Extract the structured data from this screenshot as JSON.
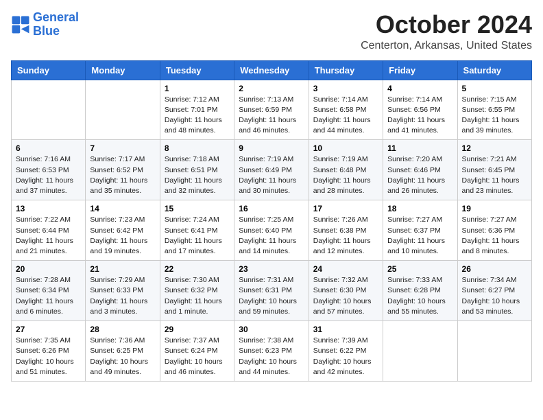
{
  "header": {
    "logo_line1": "General",
    "logo_line2": "Blue",
    "month": "October 2024",
    "location": "Centerton, Arkansas, United States"
  },
  "days_of_week": [
    "Sunday",
    "Monday",
    "Tuesday",
    "Wednesday",
    "Thursday",
    "Friday",
    "Saturday"
  ],
  "weeks": [
    [
      {
        "day": "",
        "info": ""
      },
      {
        "day": "",
        "info": ""
      },
      {
        "day": "1",
        "info": "Sunrise: 7:12 AM\nSunset: 7:01 PM\nDaylight: 11 hours and 48 minutes."
      },
      {
        "day": "2",
        "info": "Sunrise: 7:13 AM\nSunset: 6:59 PM\nDaylight: 11 hours and 46 minutes."
      },
      {
        "day": "3",
        "info": "Sunrise: 7:14 AM\nSunset: 6:58 PM\nDaylight: 11 hours and 44 minutes."
      },
      {
        "day": "4",
        "info": "Sunrise: 7:14 AM\nSunset: 6:56 PM\nDaylight: 11 hours and 41 minutes."
      },
      {
        "day": "5",
        "info": "Sunrise: 7:15 AM\nSunset: 6:55 PM\nDaylight: 11 hours and 39 minutes."
      }
    ],
    [
      {
        "day": "6",
        "info": "Sunrise: 7:16 AM\nSunset: 6:53 PM\nDaylight: 11 hours and 37 minutes."
      },
      {
        "day": "7",
        "info": "Sunrise: 7:17 AM\nSunset: 6:52 PM\nDaylight: 11 hours and 35 minutes."
      },
      {
        "day": "8",
        "info": "Sunrise: 7:18 AM\nSunset: 6:51 PM\nDaylight: 11 hours and 32 minutes."
      },
      {
        "day": "9",
        "info": "Sunrise: 7:19 AM\nSunset: 6:49 PM\nDaylight: 11 hours and 30 minutes."
      },
      {
        "day": "10",
        "info": "Sunrise: 7:19 AM\nSunset: 6:48 PM\nDaylight: 11 hours and 28 minutes."
      },
      {
        "day": "11",
        "info": "Sunrise: 7:20 AM\nSunset: 6:46 PM\nDaylight: 11 hours and 26 minutes."
      },
      {
        "day": "12",
        "info": "Sunrise: 7:21 AM\nSunset: 6:45 PM\nDaylight: 11 hours and 23 minutes."
      }
    ],
    [
      {
        "day": "13",
        "info": "Sunrise: 7:22 AM\nSunset: 6:44 PM\nDaylight: 11 hours and 21 minutes."
      },
      {
        "day": "14",
        "info": "Sunrise: 7:23 AM\nSunset: 6:42 PM\nDaylight: 11 hours and 19 minutes."
      },
      {
        "day": "15",
        "info": "Sunrise: 7:24 AM\nSunset: 6:41 PM\nDaylight: 11 hours and 17 minutes."
      },
      {
        "day": "16",
        "info": "Sunrise: 7:25 AM\nSunset: 6:40 PM\nDaylight: 11 hours and 14 minutes."
      },
      {
        "day": "17",
        "info": "Sunrise: 7:26 AM\nSunset: 6:38 PM\nDaylight: 11 hours and 12 minutes."
      },
      {
        "day": "18",
        "info": "Sunrise: 7:27 AM\nSunset: 6:37 PM\nDaylight: 11 hours and 10 minutes."
      },
      {
        "day": "19",
        "info": "Sunrise: 7:27 AM\nSunset: 6:36 PM\nDaylight: 11 hours and 8 minutes."
      }
    ],
    [
      {
        "day": "20",
        "info": "Sunrise: 7:28 AM\nSunset: 6:34 PM\nDaylight: 11 hours and 6 minutes."
      },
      {
        "day": "21",
        "info": "Sunrise: 7:29 AM\nSunset: 6:33 PM\nDaylight: 11 hours and 3 minutes."
      },
      {
        "day": "22",
        "info": "Sunrise: 7:30 AM\nSunset: 6:32 PM\nDaylight: 11 hours and 1 minute."
      },
      {
        "day": "23",
        "info": "Sunrise: 7:31 AM\nSunset: 6:31 PM\nDaylight: 10 hours and 59 minutes."
      },
      {
        "day": "24",
        "info": "Sunrise: 7:32 AM\nSunset: 6:30 PM\nDaylight: 10 hours and 57 minutes."
      },
      {
        "day": "25",
        "info": "Sunrise: 7:33 AM\nSunset: 6:28 PM\nDaylight: 10 hours and 55 minutes."
      },
      {
        "day": "26",
        "info": "Sunrise: 7:34 AM\nSunset: 6:27 PM\nDaylight: 10 hours and 53 minutes."
      }
    ],
    [
      {
        "day": "27",
        "info": "Sunrise: 7:35 AM\nSunset: 6:26 PM\nDaylight: 10 hours and 51 minutes."
      },
      {
        "day": "28",
        "info": "Sunrise: 7:36 AM\nSunset: 6:25 PM\nDaylight: 10 hours and 49 minutes."
      },
      {
        "day": "29",
        "info": "Sunrise: 7:37 AM\nSunset: 6:24 PM\nDaylight: 10 hours and 46 minutes."
      },
      {
        "day": "30",
        "info": "Sunrise: 7:38 AM\nSunset: 6:23 PM\nDaylight: 10 hours and 44 minutes."
      },
      {
        "day": "31",
        "info": "Sunrise: 7:39 AM\nSunset: 6:22 PM\nDaylight: 10 hours and 42 minutes."
      },
      {
        "day": "",
        "info": ""
      },
      {
        "day": "",
        "info": ""
      }
    ]
  ]
}
